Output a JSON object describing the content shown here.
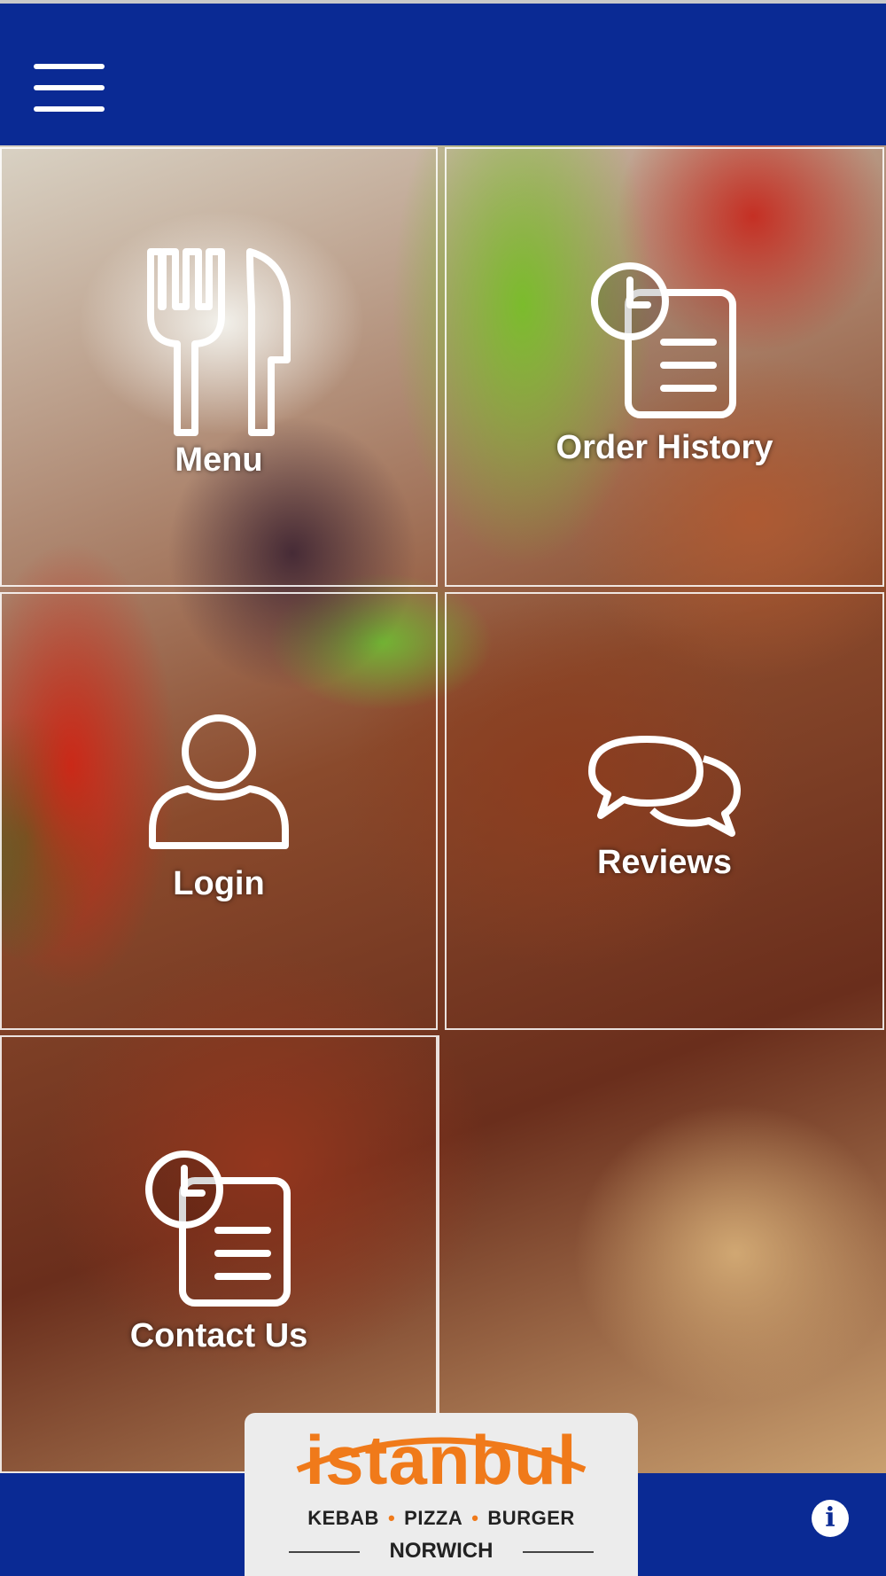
{
  "header": {
    "menu_icon": "hamburger-menu-icon"
  },
  "tiles": [
    {
      "label": "Menu",
      "icon": "fork-knife-icon"
    },
    {
      "label": "Order History",
      "icon": "clock-document-icon"
    },
    {
      "label": "Login",
      "icon": "user-icon"
    },
    {
      "label": "Reviews",
      "icon": "chat-bubbles-icon"
    },
    {
      "label": "Contact Us",
      "icon": "clock-document-icon"
    }
  ],
  "logo": {
    "brand": "istanbul",
    "tagline": [
      "KEBAB",
      "PIZZA",
      "BURGER"
    ],
    "city": "NORWICH"
  },
  "footer": {
    "info_icon": "info-icon"
  },
  "colors": {
    "bar": "#0a2a94",
    "logo_orange": "#f07a1a",
    "tile_border": "#ffffff"
  }
}
